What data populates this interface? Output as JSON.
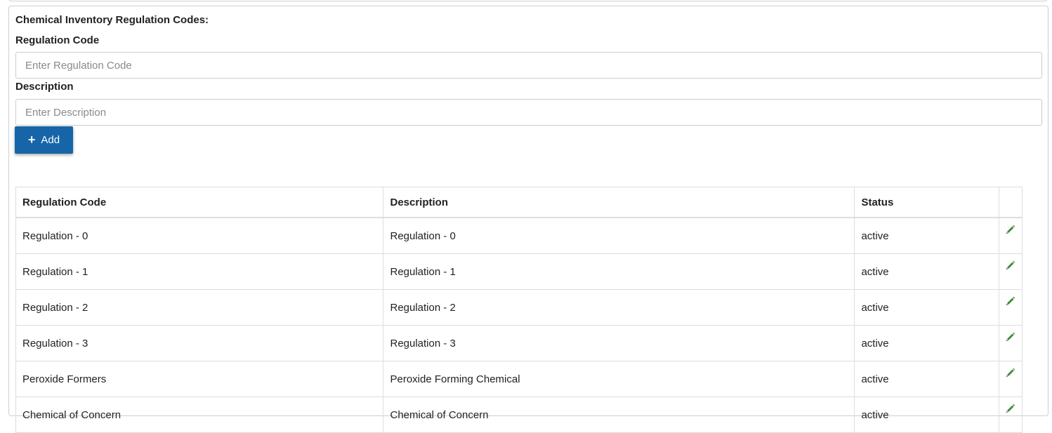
{
  "form": {
    "section_title": "Chemical Inventory Regulation Codes:",
    "code_label": "Regulation Code",
    "code_placeholder": "Enter Regulation Code",
    "code_value": "",
    "desc_label": "Description",
    "desc_placeholder": "Enter Description",
    "desc_value": "",
    "add_label": "Add",
    "add_icon": "plus-icon"
  },
  "table": {
    "headers": [
      "Regulation Code",
      "Description",
      "Status",
      ""
    ],
    "rows": [
      {
        "code": "Regulation - 0",
        "description": "Regulation - 0",
        "status": "active"
      },
      {
        "code": "Regulation - 1",
        "description": "Regulation - 1",
        "status": "active"
      },
      {
        "code": "Regulation - 2",
        "description": "Regulation - 2",
        "status": "active"
      },
      {
        "code": "Regulation - 3",
        "description": "Regulation - 3",
        "status": "active"
      },
      {
        "code": "Peroxide Formers",
        "description": "Peroxide Forming Chemical",
        "status": "active"
      },
      {
        "code": "Chemical of Concern",
        "description": "Chemical of Concern",
        "status": "active"
      }
    ],
    "edit_icon": "pencil-icon"
  },
  "colors": {
    "primary_button": "#1565a8",
    "edit_icon": "#3c8a3c",
    "border": "#dddddd"
  }
}
